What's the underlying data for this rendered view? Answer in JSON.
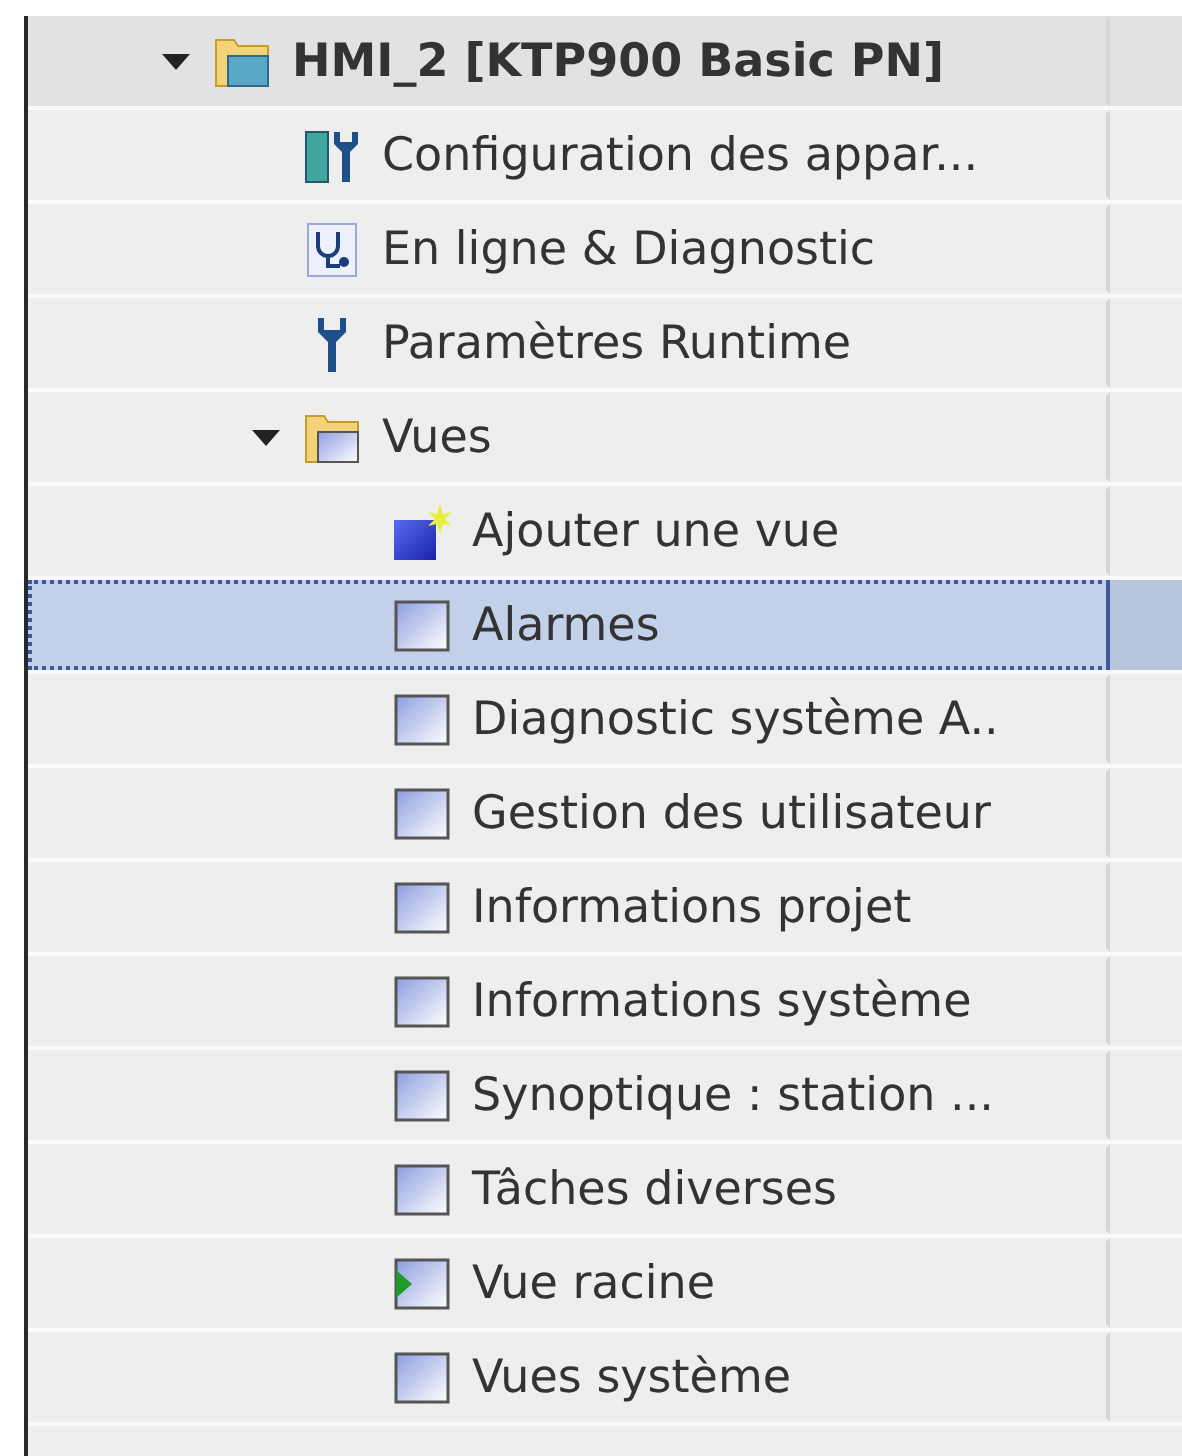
{
  "tree": [
    {
      "label": "HMI_2 [KTP900 Basic PN]",
      "kind": "device-folder",
      "expanded": true,
      "selected": false,
      "children": [
        {
          "label": "Configuration des appar...",
          "kind": "device-config",
          "selected": false
        },
        {
          "label": "En ligne & Diagnostic",
          "kind": "diagnostic",
          "selected": false
        },
        {
          "label": "Paramètres Runtime",
          "kind": "wrench",
          "selected": false
        },
        {
          "label": "Vues",
          "kind": "folder",
          "expanded": true,
          "selected": false,
          "children": [
            {
              "label": "Ajouter une vue",
              "kind": "add-screen",
              "selected": false
            },
            {
              "label": "Alarmes",
              "kind": "screen",
              "selected": true
            },
            {
              "label": "Diagnostic système A..",
              "kind": "screen",
              "selected": false
            },
            {
              "label": "Gestion des utilisateur",
              "kind": "screen",
              "selected": false
            },
            {
              "label": "Informations projet",
              "kind": "screen",
              "selected": false
            },
            {
              "label": "Informations système",
              "kind": "screen",
              "selected": false
            },
            {
              "label": "Synoptique : station ...",
              "kind": "screen",
              "selected": false
            },
            {
              "label": "Tâches diverses",
              "kind": "screen",
              "selected": false
            },
            {
              "label": "Vue racine",
              "kind": "root-screen",
              "selected": false
            },
            {
              "label": "Vues système",
              "kind": "screen",
              "selected": false
            }
          ]
        }
      ]
    }
  ]
}
